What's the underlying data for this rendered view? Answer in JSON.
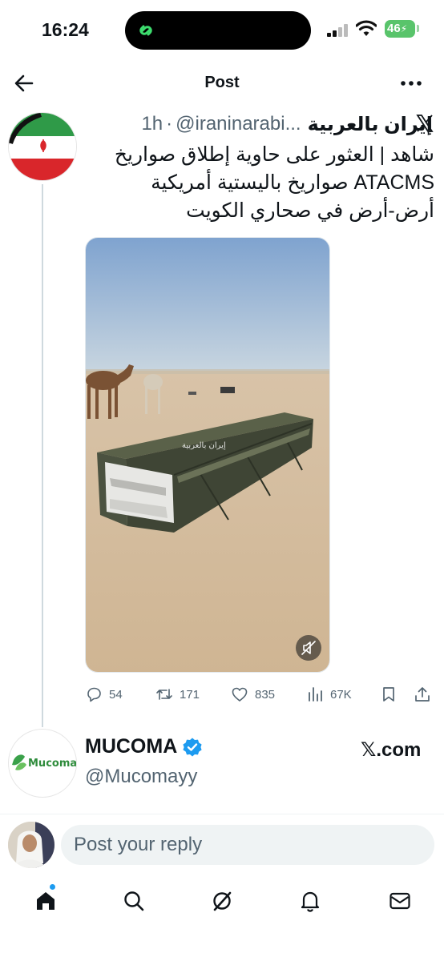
{
  "status_bar": {
    "time": "16:24",
    "battery": "46"
  },
  "header": {
    "title": "Post"
  },
  "tweet": {
    "display_name": "إيران بالعربية",
    "handle": "@iraninarabi...",
    "separator": "·",
    "time_ago": "1h",
    "text_lines": [
      "شاهد | العثور على حاوية إطلاق صواريخ",
      "ATACMS صواريخ باليستية أمريكية",
      "أرض-أرض في صحاري الكويت"
    ],
    "media_overlay": "إيران بالعربية",
    "stats": {
      "replies": "54",
      "reposts": "171",
      "likes": "835",
      "views": "67K"
    }
  },
  "ad": {
    "name": "MUCOMA",
    "handle": "@Mucomayy",
    "site": "𝕏.com",
    "logo_text": "Mucoma"
  },
  "reply": {
    "placeholder": "Post your reply"
  },
  "nav": {
    "items": [
      "home-icon",
      "search-icon",
      "grok-icon",
      "notifications-icon",
      "messages-icon"
    ]
  },
  "colors": {
    "accent": "#1d9bf0",
    "text": "#0f1419",
    "muted": "#536471",
    "battery": "#59c46b"
  }
}
